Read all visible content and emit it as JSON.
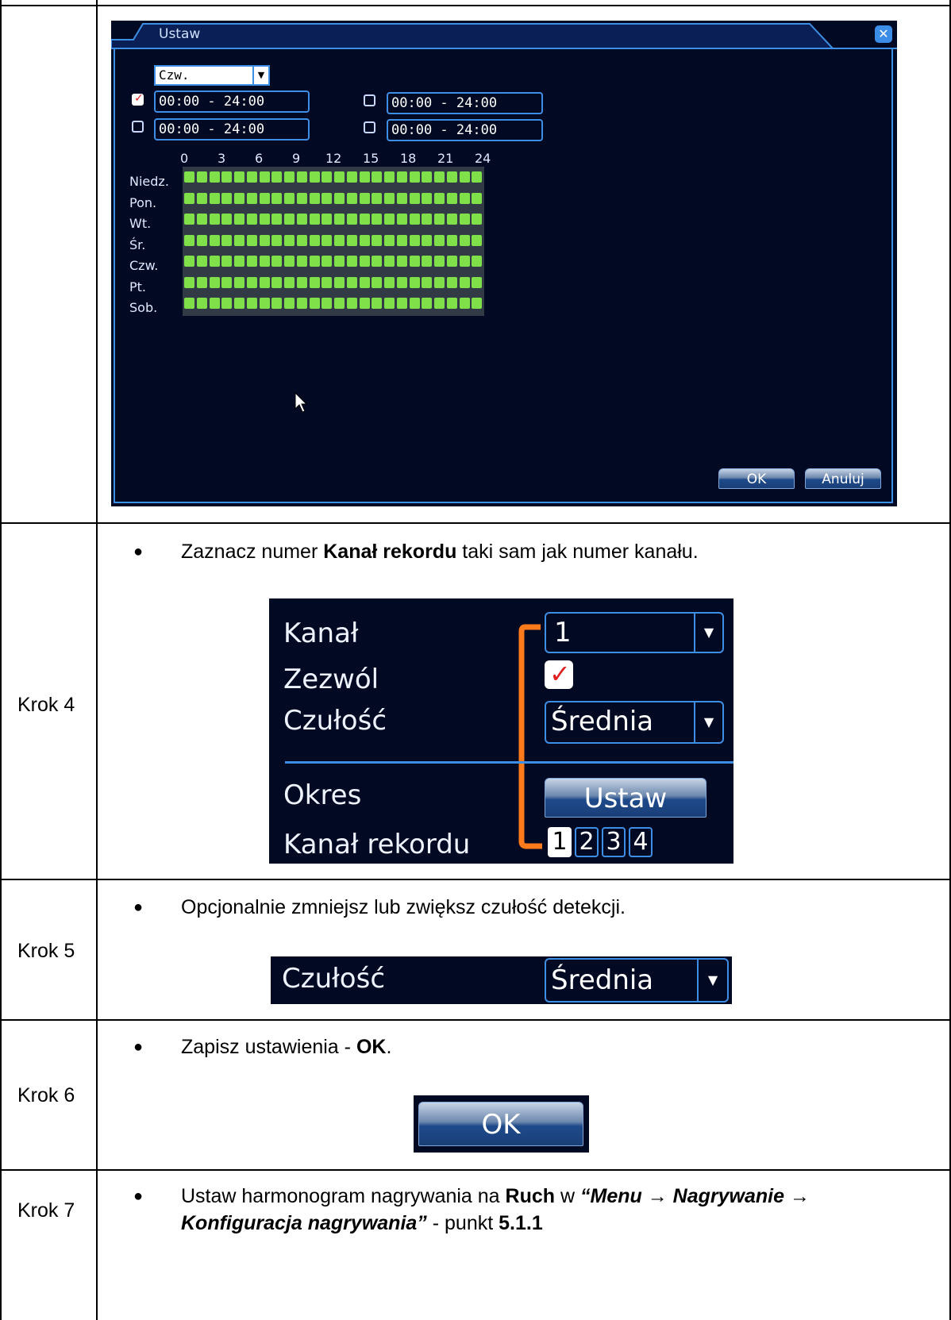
{
  "screen1": {
    "title": "Ustaw",
    "day_select": "Czw.",
    "periods": [
      {
        "checked": true,
        "range": "00:00  -  24:00"
      },
      {
        "checked": false,
        "range": "00:00  -  24:00"
      },
      {
        "checked": false,
        "range": "00:00  -  24:00"
      },
      {
        "checked": false,
        "range": "00:00  -  24:00"
      }
    ],
    "hours": [
      "0",
      "3",
      "6",
      "9",
      "12",
      "15",
      "18",
      "21",
      "24"
    ],
    "days": [
      "Niedz.",
      "Pon.",
      "Wt.",
      "Śr.",
      "Czw.",
      "Pt.",
      "Sob."
    ],
    "ok_label": "OK",
    "cancel_label": "Anuluj"
  },
  "steps": [
    {
      "label": "Krok 4"
    },
    {
      "label": "Krok 5"
    },
    {
      "label": "Krok 6"
    },
    {
      "label": "Krok 7"
    }
  ],
  "step4": {
    "text_before": "Zaznacz numer ",
    "text_bold": "Kanał rekordu",
    "text_after": " taki sam jak numer kanału.",
    "labels": {
      "kanal": "Kanał",
      "zezwol": "Zezwól",
      "czulosc": "Czułość",
      "okres": "Okres",
      "kanal_rekordu": "Kanał rekordu"
    },
    "kanal_value": "1",
    "czulosc_value": "Średnia",
    "ustaw_label": "Ustaw",
    "channels": [
      "1",
      "2",
      "3",
      "4"
    ],
    "accent_color": "#ff7a1a"
  },
  "step5": {
    "text": "Opcjonalnie zmniejsz lub zwiększ czułość detekcji.",
    "label": "Czułość",
    "value": "Średnia"
  },
  "step6": {
    "text_before": "Zapisz ustawienia - ",
    "text_bold": "OK",
    "text_after": ".",
    "button_label": "OK"
  },
  "step7": {
    "t1": "Ustaw harmonogram nagrywania na ",
    "t2": "Ruch",
    "t3": " w ",
    "t4": "“Menu → Nagrywanie →",
    "t5": "Konfiguracja nagrywania”",
    "t6": " - punkt ",
    "t7": "5.1.1"
  }
}
